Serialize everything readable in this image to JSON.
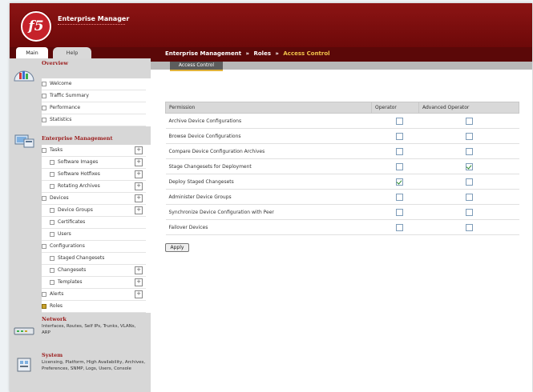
{
  "header": {
    "brand": "f5",
    "title": "Enterprise Manager"
  },
  "tabs": [
    {
      "label": "Main"
    },
    {
      "label": "Help"
    }
  ],
  "breadcrumb": {
    "items": [
      "Enterprise Management",
      "Roles"
    ],
    "current": "Access Control",
    "separator": "»"
  },
  "subtab": {
    "label": "Access Control"
  },
  "sidebar": {
    "overview": {
      "title": "Overview",
      "items": [
        "Welcome",
        "Traffic Summary",
        "Performance",
        "Statistics"
      ]
    },
    "enterprise": {
      "title": "Enterprise Management",
      "items": [
        "Tasks",
        "Software Images",
        "Software Hotfixes",
        "Rotating Archives",
        "Devices",
        "Device Groups",
        "Certificates",
        "Users",
        "Configurations",
        "Staged Changesets",
        "Changesets",
        "Templates",
        "Alerts",
        "Roles"
      ]
    },
    "network": {
      "title": "Network",
      "desc": "Interfaces, Routes, Self IPs, Trunks, VLANs, ARP"
    },
    "system": {
      "title": "System",
      "desc": "Licensing, Platform, High Availability, Archives, Preferences, SNMP, Logs, Users, Console"
    }
  },
  "table": {
    "headers": [
      "Permission",
      "Operator",
      "Advanced Operator"
    ],
    "rows": [
      {
        "permission": "Archive Device Configurations",
        "operator": false,
        "advanced": false
      },
      {
        "permission": "Browse Device Configurations",
        "operator": false,
        "advanced": false
      },
      {
        "permission": "Compare Device Configuration Archives",
        "operator": false,
        "advanced": false
      },
      {
        "permission": "Stage Changesets for Deployment",
        "operator": false,
        "advanced": true
      },
      {
        "permission": "Deploy Staged Changesets",
        "operator": true,
        "advanced": false
      },
      {
        "permission": "Administer Device Groups",
        "operator": false,
        "advanced": false
      },
      {
        "permission": "Synchronize Device Configuration with Peer",
        "operator": false,
        "advanced": false
      },
      {
        "permission": "Failover Devices",
        "operator": false,
        "advanced": false
      }
    ]
  },
  "apply_label": "Apply",
  "colors": {
    "header": "#8c1414",
    "accent": "#f2c44b",
    "sidebar": "#d7d7d7"
  }
}
